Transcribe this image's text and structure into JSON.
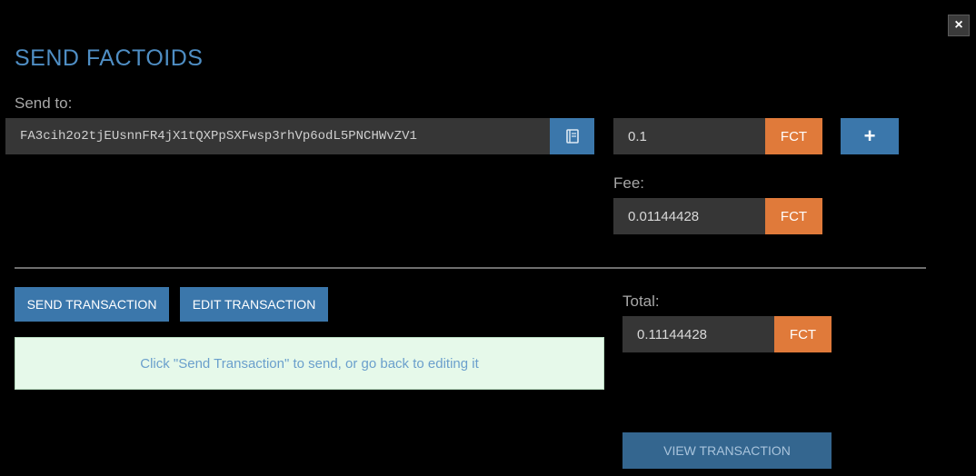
{
  "dialog": {
    "title": "SEND FACTOIDS",
    "close_glyph": "×"
  },
  "send_to": {
    "label": "Send to:",
    "address": "FA3cih2o2tjEUsnnFR4jX1tQXPpSXFwsp3rhVp6odL5PNCHWvZV1",
    "address_book_icon": "address-book-icon"
  },
  "amount": {
    "value": "0.1",
    "unit": "FCT",
    "add_glyph": "+"
  },
  "fee": {
    "label": "Fee:",
    "value": "0.01144428",
    "unit": "FCT"
  },
  "actions": {
    "send_label": "SEND TRANSACTION",
    "edit_label": "EDIT TRANSACTION",
    "view_label": "VIEW TRANSACTION"
  },
  "notice": {
    "text": "Click \"Send Transaction\" to send, or go back to editing it"
  },
  "total": {
    "label": "Total:",
    "value": "0.11144428",
    "unit": "FCT"
  },
  "colors": {
    "accent_blue": "#3b77ab",
    "unit_orange": "#e07a3a",
    "notice_bg": "#e6f9ea",
    "title_blue": "#4f8ec4"
  }
}
